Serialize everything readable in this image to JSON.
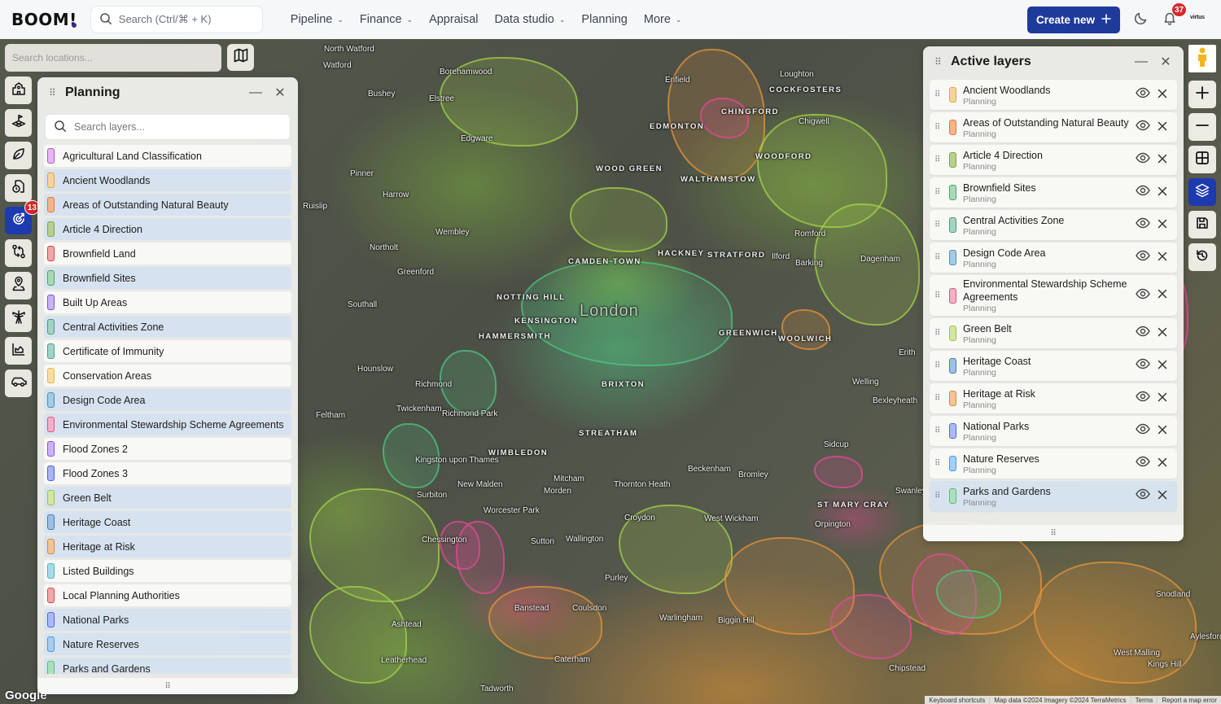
{
  "topbar": {
    "logo": "BOOM!",
    "search_placeholder": "Search (Ctrl/⌘ + K)",
    "nav": [
      {
        "label": "Pipeline",
        "has_dropdown": true
      },
      {
        "label": "Finance",
        "has_dropdown": true
      },
      {
        "label": "Appraisal",
        "has_dropdown": false
      },
      {
        "label": "Data studio",
        "has_dropdown": true
      },
      {
        "label": "Planning",
        "has_dropdown": false
      },
      {
        "label": "More",
        "has_dropdown": true
      }
    ],
    "create_button": "Create new",
    "notifications_count": "37",
    "account_logo": "virtus"
  },
  "map_controls": {
    "location_search_placeholder": "Search locations...",
    "tool_rail": [
      {
        "icon": "school-building-icon",
        "active": false
      },
      {
        "icon": "land-plot-flag-icon",
        "active": false
      },
      {
        "icon": "leaf-icon",
        "active": false
      },
      {
        "icon": "document-clock-icon",
        "active": false
      },
      {
        "icon": "planning-radar-icon",
        "active": true,
        "badge": "13"
      },
      {
        "icon": "git-compare-icon",
        "active": false
      },
      {
        "icon": "map-pin-user-icon",
        "active": false
      },
      {
        "icon": "utility-pylon-icon",
        "active": false
      },
      {
        "icon": "area-chart-icon",
        "active": false
      },
      {
        "icon": "car-icon",
        "active": false
      }
    ],
    "right_rail": [
      {
        "icon": "pegman-icon"
      },
      {
        "icon": "zoom-in-icon"
      },
      {
        "icon": "zoom-out-icon"
      },
      {
        "icon": "grid-icon"
      },
      {
        "icon": "layers-icon",
        "active": true
      },
      {
        "icon": "save-icon"
      },
      {
        "icon": "history-icon"
      }
    ]
  },
  "planning_panel": {
    "title": "Planning",
    "search_placeholder": "Search layers...",
    "layers": [
      {
        "label": "Agricultural Land Classification",
        "color": "#c04fd8",
        "fill": "#e9b6f2",
        "active": false
      },
      {
        "label": "Ancient Woodlands",
        "color": "#e0a54a",
        "fill": "#f5d39c",
        "active": true
      },
      {
        "label": "Areas of Outstanding Natural Beauty",
        "color": "#e07a3e",
        "fill": "#f4b48c",
        "active": true
      },
      {
        "label": "Article 4 Direction",
        "color": "#7ea64a",
        "fill": "#b7cf8f",
        "active": true
      },
      {
        "label": "Brownfield Land",
        "color": "#d24848",
        "fill": "#f0a8a8",
        "active": false
      },
      {
        "label": "Brownfield Sites",
        "color": "#4ea36a",
        "fill": "#a8d9b4",
        "active": true
      },
      {
        "label": "Built Up Areas",
        "color": "#7a4fd8",
        "fill": "#c7b4f2",
        "active": false
      },
      {
        "label": "Central Activities Zone",
        "color": "#4a9a7e",
        "fill": "#a4d3c1",
        "active": true
      },
      {
        "label": "Certificate of Immunity",
        "color": "#4a9a8a",
        "fill": "#a4d3c8",
        "active": false
      },
      {
        "label": "Conservation Areas",
        "color": "#e3b84a",
        "fill": "#f6dfa0",
        "active": false
      },
      {
        "label": "Design Code Area",
        "color": "#4a8fb8",
        "fill": "#a4cbe2",
        "active": true
      },
      {
        "label": "Environmental Stewardship Scheme Agreements",
        "color": "#d9557f",
        "fill": "#f2b0c6",
        "active": true
      },
      {
        "label": "Flood Zones 2",
        "color": "#8a4fe0",
        "fill": "#cbb4f5",
        "active": false
      },
      {
        "label": "Flood Zones 3",
        "color": "#4a62d8",
        "fill": "#a9b6f0",
        "active": false
      },
      {
        "label": "Green Belt",
        "color": "#9ec24a",
        "fill": "#d3e6a3",
        "active": true
      },
      {
        "label": "Heritage Coast",
        "color": "#3e7bbf",
        "fill": "#9fc0e3",
        "active": true
      },
      {
        "label": "Heritage at Risk",
        "color": "#d98a3a",
        "fill": "#f2c496",
        "active": true
      },
      {
        "label": "Listed Buildings",
        "color": "#4ab3c8",
        "fill": "#a8dde8",
        "active": false
      },
      {
        "label": "Local Planning Authorities",
        "color": "#d94a4a",
        "fill": "#f2aaaa",
        "active": false
      },
      {
        "label": "National Parks",
        "color": "#4a6ae0",
        "fill": "#acbaf4",
        "active": true
      },
      {
        "label": "Nature Reserves",
        "color": "#4a9ae0",
        "fill": "#a8cdf2",
        "active": true
      },
      {
        "label": "Parks and Gardens",
        "color": "#5ab878",
        "fill": "#ace0bc",
        "active": true
      }
    ]
  },
  "active_panel": {
    "title": "Active layers",
    "layers": [
      {
        "label": "Ancient Woodlands",
        "category": "Planning",
        "color": "#e0a54a",
        "fill": "#f5d39c",
        "selected": false
      },
      {
        "label": "Areas of Outstanding Natural Beauty",
        "category": "Planning",
        "color": "#e07a3e",
        "fill": "#f4b48c",
        "selected": false
      },
      {
        "label": "Article 4 Direction",
        "category": "Planning",
        "color": "#7ea64a",
        "fill": "#b7cf8f",
        "selected": false
      },
      {
        "label": "Brownfield Sites",
        "category": "Planning",
        "color": "#4ea36a",
        "fill": "#a8d9b4",
        "selected": false
      },
      {
        "label": "Central Activities Zone",
        "category": "Planning",
        "color": "#4a9a7e",
        "fill": "#a4d3c1",
        "selected": false
      },
      {
        "label": "Design Code Area",
        "category": "Planning",
        "color": "#4a8fb8",
        "fill": "#a4cbe2",
        "selected": false
      },
      {
        "label": "Environmental Stewardship Scheme Agreements",
        "category": "Planning",
        "color": "#d9557f",
        "fill": "#f2b0c6",
        "selected": false
      },
      {
        "label": "Green Belt",
        "category": "Planning",
        "color": "#9ec24a",
        "fill": "#d3e6a3",
        "selected": false
      },
      {
        "label": "Heritage Coast",
        "category": "Planning",
        "color": "#3e7bbf",
        "fill": "#9fc0e3",
        "selected": false
      },
      {
        "label": "Heritage at Risk",
        "category": "Planning",
        "color": "#d98a3a",
        "fill": "#f2c496",
        "selected": false
      },
      {
        "label": "National Parks",
        "category": "Planning",
        "color": "#4a6ae0",
        "fill": "#acbaf4",
        "selected": false
      },
      {
        "label": "Nature Reserves",
        "category": "Planning",
        "color": "#4a9ae0",
        "fill": "#a8cdf2",
        "selected": false
      },
      {
        "label": "Parks and Gardens",
        "category": "Planning",
        "color": "#5ab878",
        "fill": "#ace0bc",
        "selected": true
      }
    ]
  },
  "map": {
    "place_labels": [
      {
        "text": "North Watford",
        "style": "normal"
      },
      {
        "text": "Watford",
        "style": "normal"
      },
      {
        "text": "Borehamwood",
        "style": "normal"
      },
      {
        "text": "Enfield",
        "style": "normal"
      },
      {
        "text": "COCKFOSTERS",
        "style": "caps"
      },
      {
        "text": "Bushey",
        "style": "normal"
      },
      {
        "text": "Elstree",
        "style": "normal"
      },
      {
        "text": "Edgware",
        "style": "normal"
      },
      {
        "text": "Pinner",
        "style": "normal"
      },
      {
        "text": "Harrow",
        "style": "normal"
      },
      {
        "text": "Ruislip",
        "style": "normal"
      },
      {
        "text": "Wembley",
        "style": "normal"
      },
      {
        "text": "EDMONTON",
        "style": "caps"
      },
      {
        "text": "CHINGFORD",
        "style": "caps"
      },
      {
        "text": "WOOD GREEN",
        "style": "caps"
      },
      {
        "text": "WALTHAMSTOW",
        "style": "caps"
      },
      {
        "text": "WOODFORD",
        "style": "caps"
      },
      {
        "text": "Chigwell",
        "style": "normal"
      },
      {
        "text": "Loughton",
        "style": "normal"
      },
      {
        "text": "Romford",
        "style": "normal"
      },
      {
        "text": "Ilford",
        "style": "normal"
      },
      {
        "text": "Dagenham",
        "style": "normal"
      },
      {
        "text": "Barking",
        "style": "normal"
      },
      {
        "text": "Greenford",
        "style": "normal"
      },
      {
        "text": "Northolt",
        "style": "normal"
      },
      {
        "text": "Southall",
        "style": "normal"
      },
      {
        "text": "CAMDEN TOWN",
        "style": "caps"
      },
      {
        "text": "HACKNEY",
        "style": "caps"
      },
      {
        "text": "STRATFORD",
        "style": "caps"
      },
      {
        "text": "NOTTING HILL",
        "style": "caps"
      },
      {
        "text": "London",
        "style": "city"
      },
      {
        "text": "KENSINGTON",
        "style": "caps"
      },
      {
        "text": "HAMMERSMITH",
        "style": "caps"
      },
      {
        "text": "GREENWICH",
        "style": "caps"
      },
      {
        "text": "WOOLWICH",
        "style": "caps"
      },
      {
        "text": "Erith",
        "style": "normal"
      },
      {
        "text": "Hounslow",
        "style": "normal"
      },
      {
        "text": "Richmond",
        "style": "normal"
      },
      {
        "text": "Richmond Park",
        "style": "normal"
      },
      {
        "text": "Twickenham",
        "style": "normal"
      },
      {
        "text": "Feltham",
        "style": "normal"
      },
      {
        "text": "BRIXTON",
        "style": "caps"
      },
      {
        "text": "STREATHAM",
        "style": "caps"
      },
      {
        "text": "WIMBLEDON",
        "style": "caps"
      },
      {
        "text": "Welling",
        "style": "normal"
      },
      {
        "text": "Bexleyheath",
        "style": "normal"
      },
      {
        "text": "Sidcup",
        "style": "normal"
      },
      {
        "text": "Kingston upon Thames",
        "style": "normal"
      },
      {
        "text": "New Malden",
        "style": "normal"
      },
      {
        "text": "Mitcham",
        "style": "normal"
      },
      {
        "text": "Morden",
        "style": "normal"
      },
      {
        "text": "Surbiton",
        "style": "normal"
      },
      {
        "text": "Thornton Heath",
        "style": "normal"
      },
      {
        "text": "Beckenham",
        "style": "normal"
      },
      {
        "text": "Bromley",
        "style": "normal"
      },
      {
        "text": "Swanley",
        "style": "normal"
      },
      {
        "text": "Worcester Park",
        "style": "normal"
      },
      {
        "text": "Croydon",
        "style": "normal"
      },
      {
        "text": "West Wickham",
        "style": "normal"
      },
      {
        "text": "ST MARY CRAY",
        "style": "caps"
      },
      {
        "text": "Orpington",
        "style": "normal"
      },
      {
        "text": "Chessington",
        "style": "normal"
      },
      {
        "text": "Sutton",
        "style": "normal"
      },
      {
        "text": "Wallington",
        "style": "normal"
      },
      {
        "text": "Purley",
        "style": "normal"
      },
      {
        "text": "Banstead",
        "style": "normal"
      },
      {
        "text": "Coulsdon",
        "style": "normal"
      },
      {
        "text": "Ashtead",
        "style": "normal"
      },
      {
        "text": "Warlingham",
        "style": "normal"
      },
      {
        "text": "Biggin Hill",
        "style": "normal"
      },
      {
        "text": "Leatherhead",
        "style": "normal"
      },
      {
        "text": "Tadworth",
        "style": "normal"
      },
      {
        "text": "Caterham",
        "style": "normal"
      },
      {
        "text": "West Malling",
        "style": "normal"
      },
      {
        "text": "Kings Hill",
        "style": "normal"
      },
      {
        "text": "Aylesford",
        "style": "normal"
      },
      {
        "text": "Snodland",
        "style": "normal"
      },
      {
        "text": "Chipstead",
        "style": "normal"
      }
    ],
    "provider_logo": "Google",
    "attribution": [
      "Keyboard shortcuts",
      "Map data ©2024 Imagery ©2024 TerraMetrics",
      "Terms",
      "Report a map error"
    ]
  }
}
